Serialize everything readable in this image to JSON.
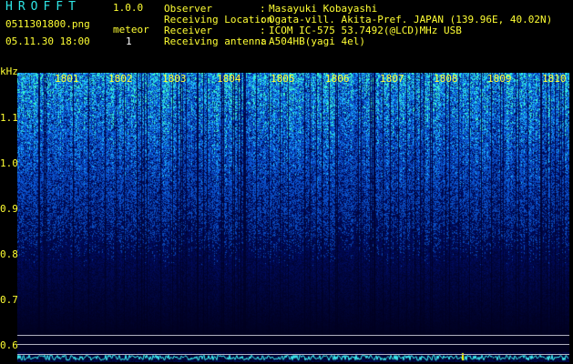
{
  "header": {
    "app_name": "HROFFT",
    "version": "1.0.0",
    "filename": "0511301800.png",
    "counter_label": "meteor",
    "counter_value": "1",
    "datetime": "05.11.30 18:00"
  },
  "metadata": [
    {
      "label": "Observer",
      "value": "Masayuki Kobayashi"
    },
    {
      "label": "Receiving Location",
      "value": "Ogata-vill. Akita-Pref. JAPAN (139.96E, 40.02N)"
    },
    {
      "label": "Receiver",
      "value": "ICOM IC-575 53.7492(@LCD)MHz USB"
    },
    {
      "label": "Receiving antenna",
      "value": "A504HB(yagi 4el)"
    }
  ],
  "spectrogram": {
    "y_unit": "kHz",
    "y_ticks": [
      "1.1",
      "1.0",
      "0.9",
      "0.8",
      "0.7",
      "0.6"
    ],
    "time_ticks": [
      "1801",
      "1802",
      "1803",
      "1804",
      "1805",
      "1806",
      "1807",
      "1808",
      "1809",
      "1810"
    ],
    "colors": {
      "noise_low": "#00003a",
      "noise_mid": "#1c4cff",
      "noise_high": "#40ffd0",
      "trace": "#ffff00"
    }
  }
}
